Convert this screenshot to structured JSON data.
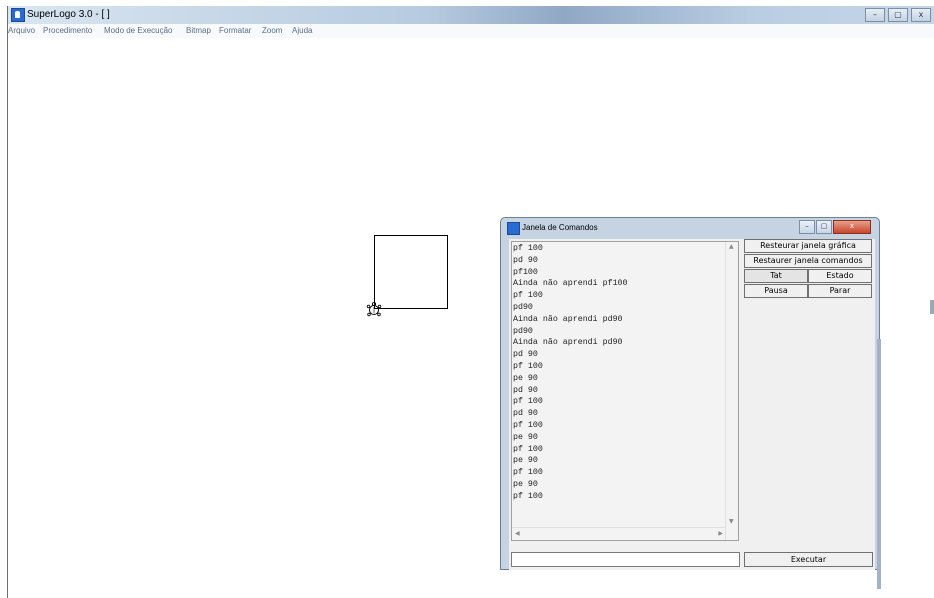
{
  "window": {
    "title": "SuperLogo 3.0 - [ ]",
    "controls": [
      "–",
      "▢",
      "x"
    ]
  },
  "menu": [
    "Arquivo",
    "Procedimento",
    "Modo de Execução",
    "Bitmap",
    "Formatar",
    "Zoom",
    "Ajuda"
  ],
  "command_window": {
    "title": "Janela de Comandos",
    "buttons": {
      "restore_graphics": "Resteurar janela gráfica",
      "restore_commands": "Restaurer janela comandos",
      "tat": "Tat",
      "estado": "Estado",
      "pausa": "Pausa",
      "parar": "Parar",
      "executar": "Executar"
    },
    "input_value": "",
    "output_lines": [
      "pf 100",
      "pd 90",
      "pf100",
      "Ainda não aprendi pf100",
      "pf 100",
      "pd90",
      "Ainda não aprendi pd90",
      "pd90",
      "Ainda não aprendi pd90",
      "pd 90",
      "pf 100",
      "pe 90",
      "pd 90",
      "pf 100",
      "pd 90",
      "pf 100",
      "pe 90",
      "pf 100",
      "pe 90",
      "pf 100",
      "pe 90",
      "pf 100"
    ]
  },
  "colors": {
    "accent": "#2a6bd1",
    "window_frame": "#c5d3e3",
    "close_button": "#c8452c"
  }
}
